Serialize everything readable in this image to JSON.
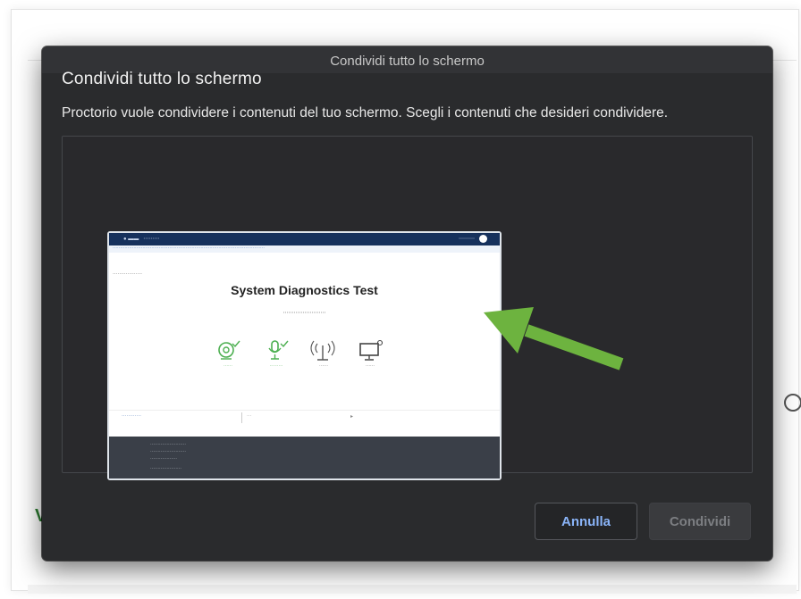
{
  "background": {
    "partial_char": "V"
  },
  "dialog": {
    "window_title": "Condividi tutto lo schermo",
    "heading": "Condividi tutto lo schermo",
    "subtitle": "Proctorio vuole condividere i contenuti del tuo schermo. Scegli i contenuti che desideri condividere.",
    "cancel_label": "Annulla",
    "share_label": "Condividi",
    "cancel_color": "#8ab4f8",
    "share_state": "disabled"
  },
  "screen_thumbnail": {
    "page_title": "System Diagnostics Test",
    "diagnostics": [
      {
        "icon": "webcam-icon",
        "status": "pass"
      },
      {
        "icon": "microphone-icon",
        "status": "pass"
      },
      {
        "icon": "connection-icon",
        "status": "neutral"
      },
      {
        "icon": "desktop-icon",
        "status": "neutral"
      }
    ]
  },
  "annotation": {
    "arrow_color": "#6db33f",
    "arrow_direction": "up-left"
  }
}
